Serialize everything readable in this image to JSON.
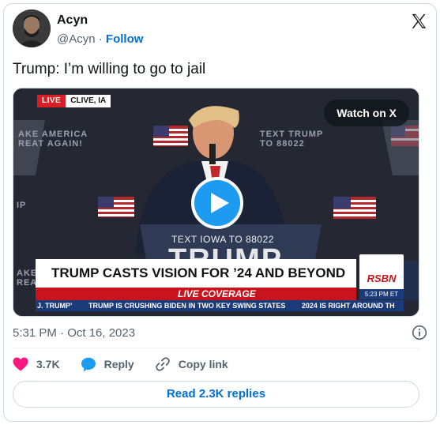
{
  "author": {
    "name": "Acyn",
    "handle": "@Acyn",
    "separator": "·",
    "follow_label": "Follow"
  },
  "tweet": {
    "text": "Trump: I’m willing to go to jail",
    "timestamp": "5:31 PM · Oct 16, 2023"
  },
  "media": {
    "watch_label": "Watch on X",
    "live_label": "LIVE",
    "location": "CLIVE, IA",
    "headline": "TRUMP CASTS VISION FOR ’24 AND BEYOND",
    "live_coverage": "LIVE COVERAGE",
    "network": "RSBN",
    "network_time": "5:23 PM ET",
    "ticker": [
      "J. TRUMP’",
      "TRUMP IS CRUSHING BIDEN IN TWO KEY SWING STATES",
      "2024 IS RIGHT AROUND TH"
    ],
    "podium_text": "TEXT IOWA TO 88022",
    "podium_word": "TRUMP",
    "backdrop_left": "AKE AMERICA\nREAT AGAIN!",
    "backdrop_right": "TEXT TRUMP\nTO 88022",
    "backdrop_left_low": "IP",
    "backdrop_left_bottom": "AKE\nREA"
  },
  "actions": {
    "likes": "3.7K",
    "reply_label": "Reply",
    "copy_label": "Copy link"
  },
  "read_replies_label": "Read 2.3K replies",
  "colors": {
    "accent": "#006fd6",
    "like": "#f91880",
    "reply": "#1d9bf0",
    "muted": "#536471"
  }
}
